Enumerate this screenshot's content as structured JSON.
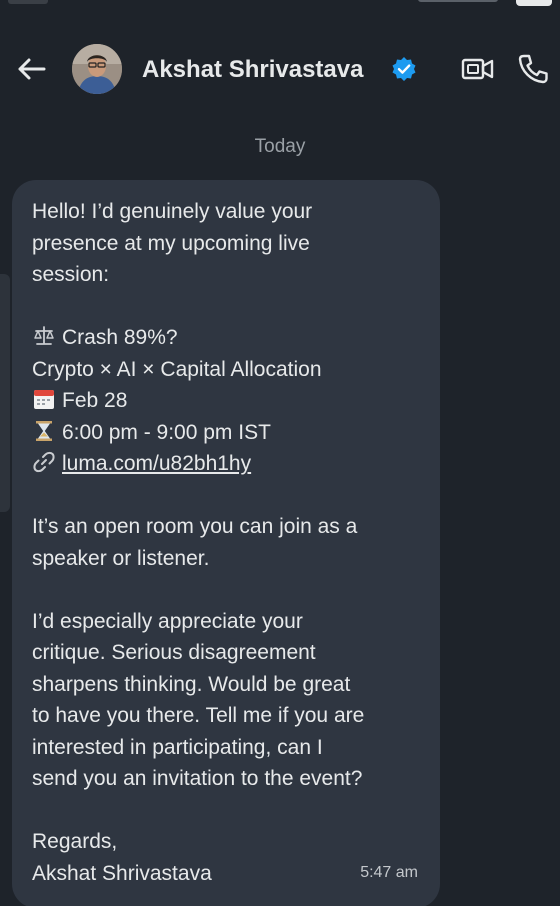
{
  "header": {
    "contact_name": "Akshat Shrivastava",
    "verified": true,
    "back_icon": "arrow-left-icon",
    "video_icon": "video-call-icon",
    "phone_icon": "phone-call-icon",
    "accent_color": "#1d9bf0"
  },
  "conversation": {
    "date_divider": "Today"
  },
  "message": {
    "intro": [
      "Hello! I’d genuinely value your",
      "presence at my upcoming live",
      "session:"
    ],
    "event_title": "Crash 89%?",
    "event_title_icon": "balance-scale-icon",
    "event_subtitle": "Crypto × AI × Capital Allocation",
    "event_date": "Feb 28",
    "event_date_icon": "calendar-icon",
    "event_time": "6:00 pm - 9:00 pm IST",
    "event_time_icon": "hourglass-icon",
    "event_link": "luma.com/u82bh1hy",
    "event_link_icon": "link-icon",
    "room": [
      "It’s an open room you can join as a",
      "speaker or listener."
    ],
    "critique": [
      "I’d especially appreciate your",
      "critique. Serious disagreement",
      "sharpens thinking. Would be great",
      "to have you there. Tell me if you are",
      "interested in participating, can I",
      "send you an invitation to the event?"
    ],
    "signoff": "Regards,",
    "signature": "Akshat Shrivastava",
    "time": "5:47 am"
  }
}
